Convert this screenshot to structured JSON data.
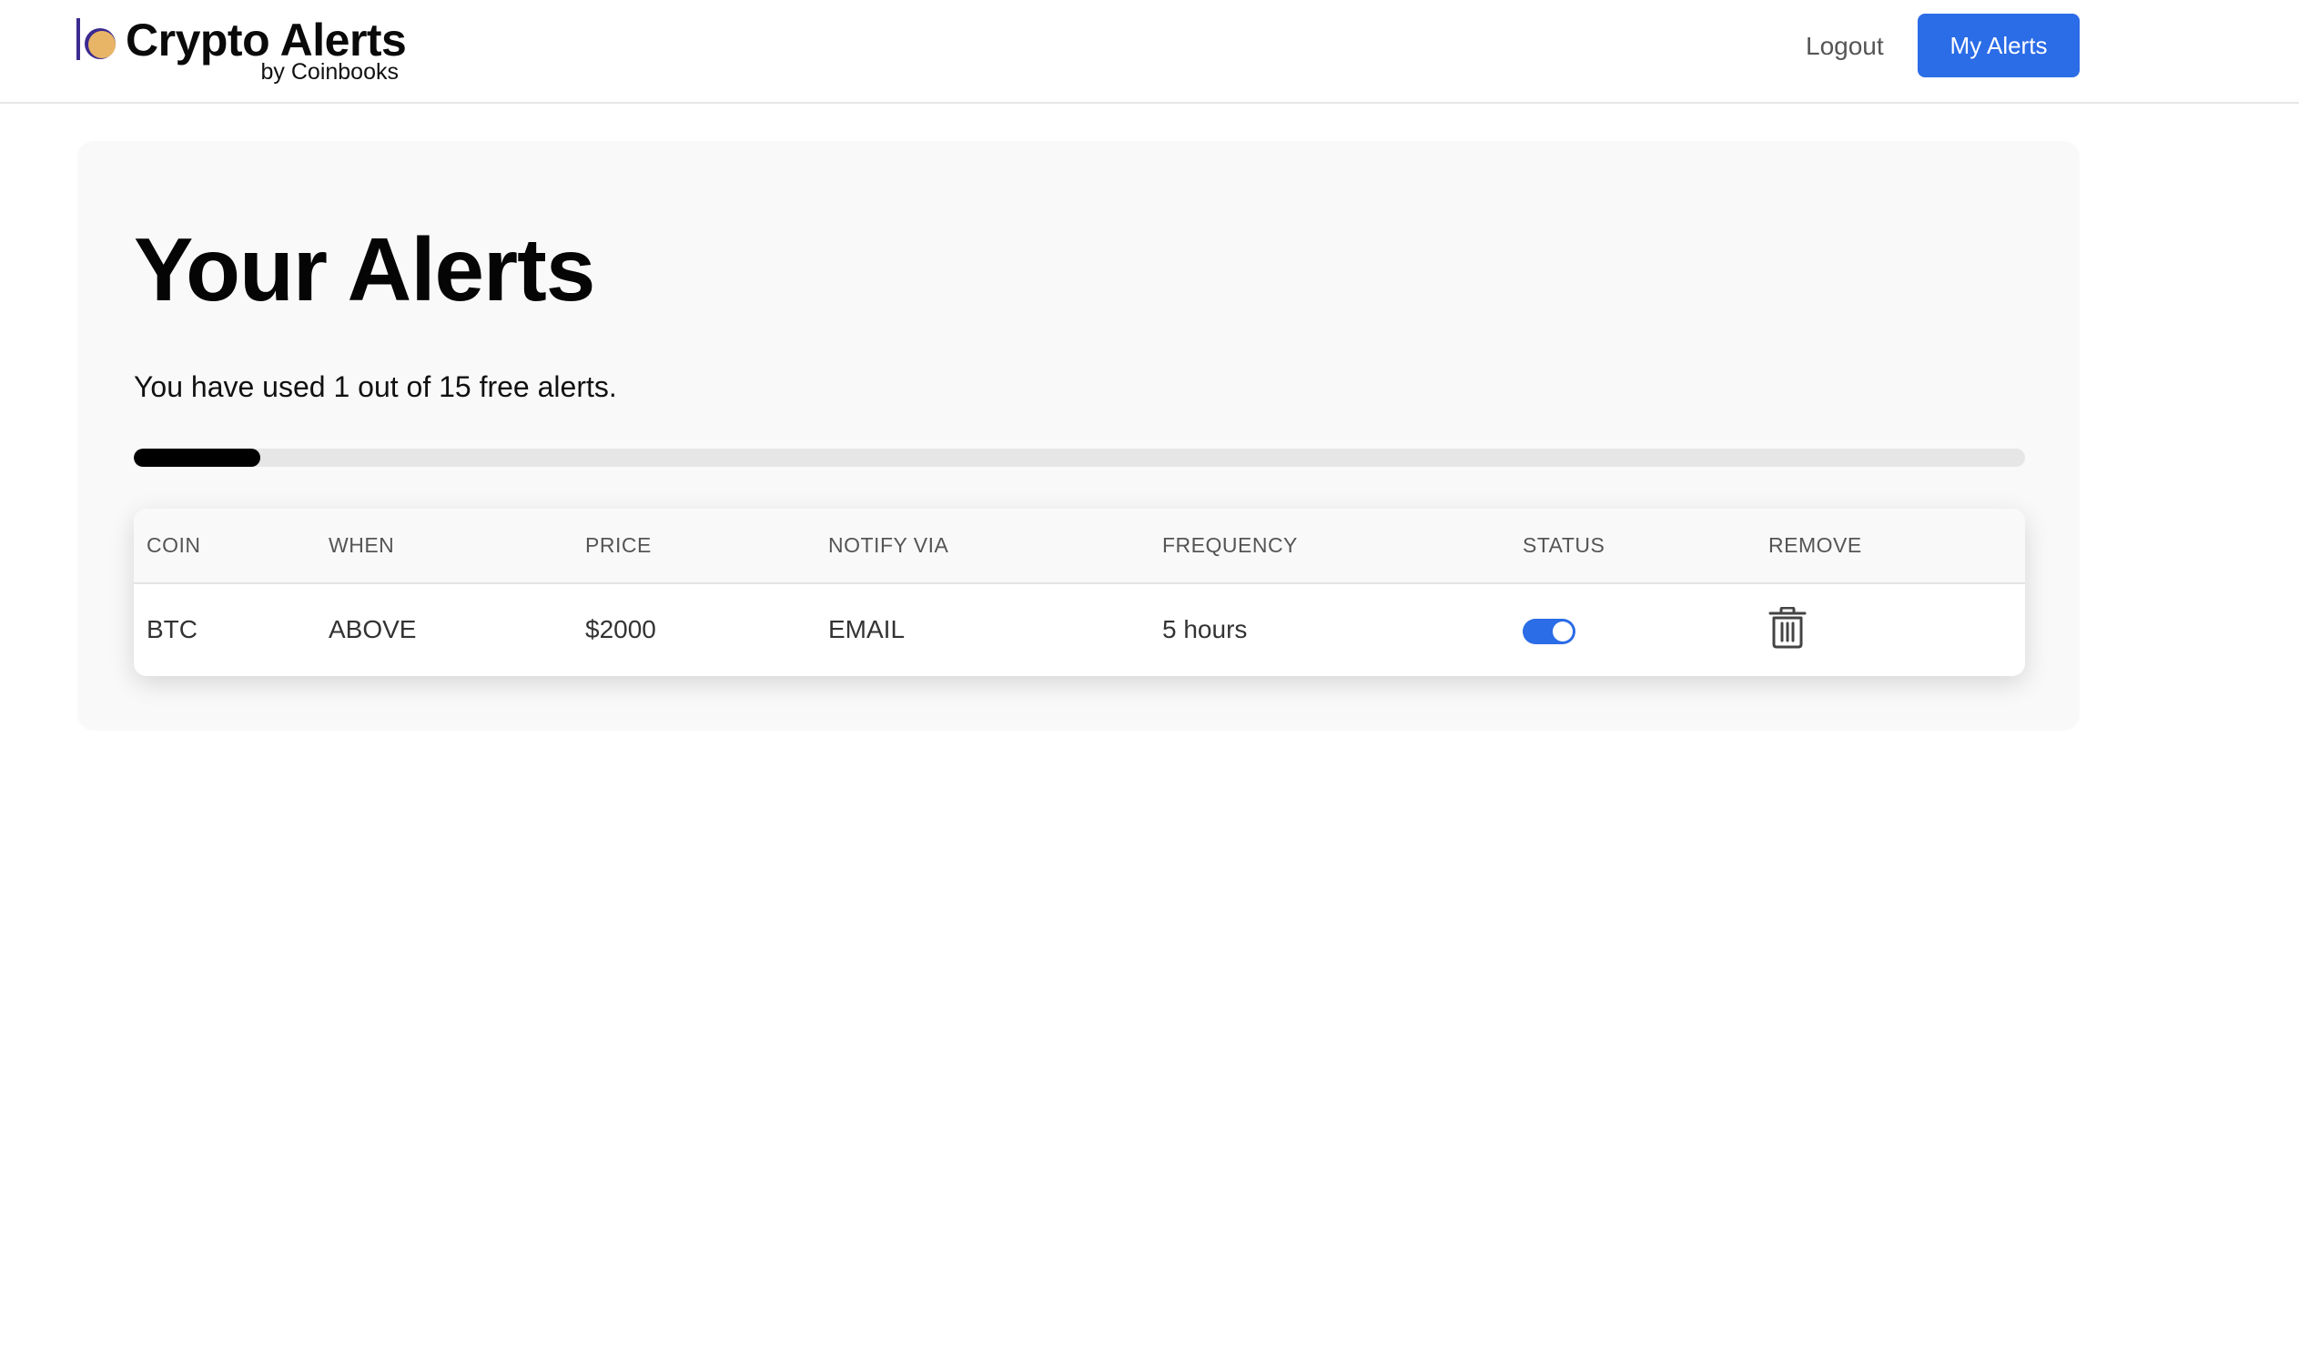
{
  "navbar": {
    "brand_title": "Crypto Alerts",
    "brand_subtitle": "by Coinbooks",
    "logout_label": "Logout",
    "my_alerts_label": "My Alerts"
  },
  "page": {
    "title": "Your Alerts",
    "usage_text": "You have used 1 out of 15 free alerts.",
    "usage": {
      "used": 1,
      "total": 15
    }
  },
  "table": {
    "columns": [
      "COIN",
      "WHEN",
      "PRICE",
      "NOTIFY VIA",
      "FREQUENCY",
      "STATUS",
      "REMOVE"
    ],
    "rows": [
      {
        "coin": "BTC",
        "when": "ABOVE",
        "price": "$2000",
        "notify_via": "EMAIL",
        "frequency": "5 hours",
        "status_enabled": true,
        "remove_icon": "trash-icon"
      }
    ]
  },
  "colors": {
    "primary": "#2b6ce7",
    "logo_purple": "#3b2a8f",
    "logo_coin": "#e8b466",
    "progress_fill": "#000000",
    "progress_track": "#e6e6e6"
  }
}
